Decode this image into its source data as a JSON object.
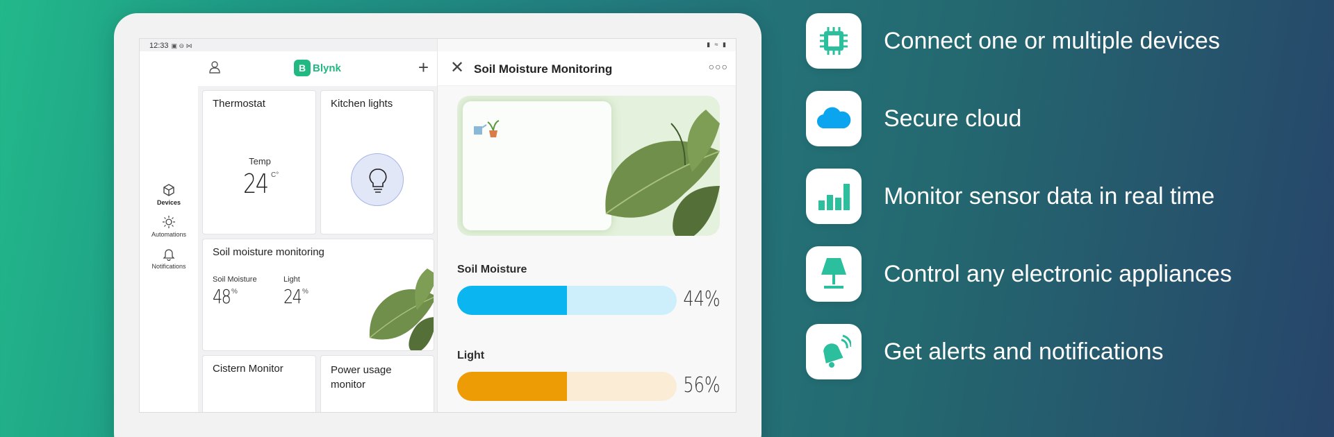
{
  "status": {
    "time": "12:33",
    "icons": "▣ ⊖ ⋈",
    "right_icons": "▮ ≈ ▮"
  },
  "rail": [
    {
      "label": "Devices",
      "icon": "cube-icon"
    },
    {
      "label": "Automations",
      "icon": "sun-icon"
    },
    {
      "label": "Notifications",
      "icon": "bell-icon"
    }
  ],
  "brand": {
    "badge": "B",
    "name": "Blynk"
  },
  "tiles": {
    "thermostat": {
      "title": "Thermostat",
      "temp_label": "Temp",
      "temp_value": "24",
      "temp_unit": "C°"
    },
    "kitchen": {
      "title": "Kitchen lights"
    },
    "soil": {
      "title": "Soil moisture monitoring",
      "moisture_label": "Soil Moisture",
      "moisture_value": "48",
      "moisture_unit": "%",
      "light_label": "Light",
      "light_value": "24",
      "light_unit": "%"
    },
    "cistern": {
      "title": "Cistern Monitor"
    },
    "power": {
      "title": "Power usage monitor"
    }
  },
  "panel": {
    "title": "Soil Moisture Monitoring",
    "metrics": [
      {
        "label": "Soil Moisture",
        "value_text": "44%",
        "fraction": 0.5,
        "color": "#0ab5f0",
        "track": "#cdeffb"
      },
      {
        "label": "Light",
        "value_text": "56%",
        "fraction": 0.5,
        "color": "#ee9c06",
        "track": "#fbecd6"
      }
    ]
  },
  "features": [
    {
      "text": "Connect one or multiple devices",
      "icon": "chip-icon"
    },
    {
      "text": "Secure cloud",
      "icon": "cloud-icon"
    },
    {
      "text": "Monitor sensor data in real time",
      "icon": "bar-chart-icon"
    },
    {
      "text": "Control any electronic appliances",
      "icon": "lamp-icon"
    },
    {
      "text": "Get alerts and notifications",
      "icon": "notification-bell-icon"
    }
  ],
  "colors": {
    "accent": "#21b881",
    "feature_icon": "#2bbf9d"
  }
}
